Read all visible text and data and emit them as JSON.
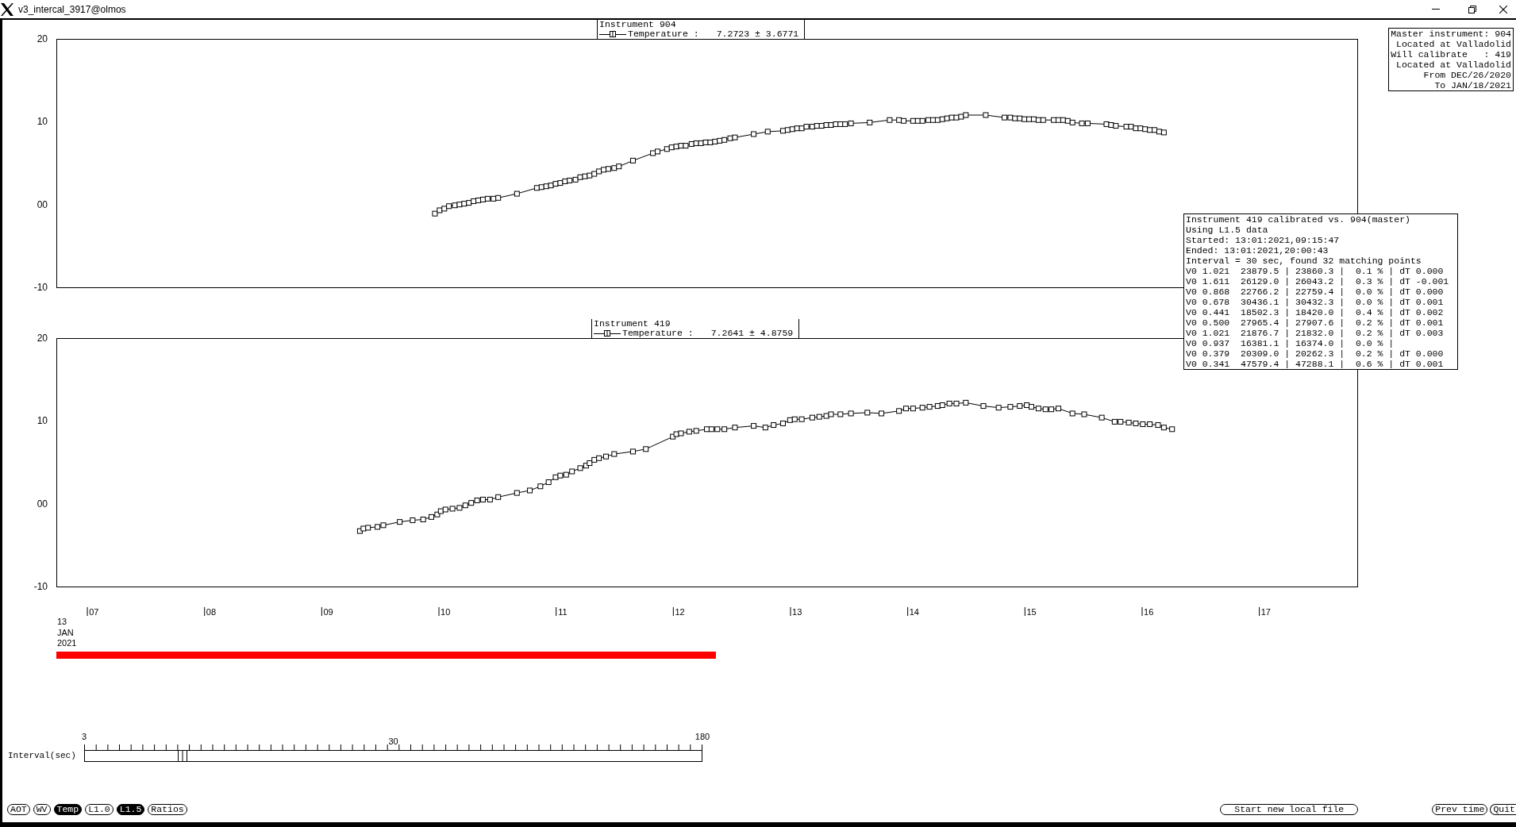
{
  "window": {
    "title": "v3_intercal_3917@olmos"
  },
  "charts": [
    {
      "legend": {
        "title": "Instrument 904",
        "label": "Temperature :",
        "stat": "7.2723 ± 3.6771"
      },
      "chart_data": {
        "type": "line",
        "marker": "square",
        "xlim": [
          6.68,
          17.78
        ],
        "ylim": [
          -10,
          20
        ],
        "yticks": [
          -10,
          {
            "value": 0,
            "label": "00"
          },
          10,
          20
        ],
        "x": [
          9.91,
          9.95,
          9.99,
          10.03,
          10.08,
          10.12,
          10.16,
          10.2,
          10.24,
          10.28,
          10.32,
          10.36,
          10.41,
          10.45,
          10.61,
          10.78,
          10.82,
          10.86,
          10.9,
          10.94,
          10.98,
          11.02,
          11.06,
          11.11,
          11.15,
          11.19,
          11.23,
          11.27,
          11.31,
          11.35,
          11.39,
          11.44,
          11.48,
          11.6,
          11.77,
          11.81,
          11.89,
          11.93,
          11.97,
          12.01,
          12.05,
          12.1,
          12.14,
          12.18,
          12.22,
          12.26,
          12.3,
          12.34,
          12.38,
          12.43,
          12.47,
          12.63,
          12.75,
          12.88,
          12.92,
          12.96,
          13.0,
          13.04,
          13.08,
          13.13,
          13.17,
          13.21,
          13.25,
          13.29,
          13.33,
          13.37,
          13.41,
          13.46,
          13.62,
          13.79,
          13.87,
          13.91,
          13.99,
          14.03,
          14.07,
          14.12,
          14.16,
          14.2,
          14.24,
          14.28,
          14.32,
          14.36,
          14.4,
          14.44,
          14.61,
          14.77,
          14.82,
          14.86,
          14.9,
          14.94,
          14.98,
          15.02,
          15.06,
          15.1,
          15.19,
          15.23,
          15.27,
          15.31,
          15.35,
          15.43,
          15.48,
          15.64,
          15.68,
          15.72,
          15.81,
          15.85,
          15.89,
          15.93,
          15.97,
          16.01,
          16.05,
          16.09,
          16.13
        ],
        "values": [
          -1.1,
          -0.7,
          -0.5,
          -0.2,
          -0.1,
          0.0,
          0.1,
          0.2,
          0.4,
          0.5,
          0.6,
          0.7,
          0.7,
          0.8,
          1.3,
          2.0,
          2.1,
          2.2,
          2.3,
          2.5,
          2.6,
          2.8,
          2.9,
          3.0,
          3.3,
          3.4,
          3.5,
          3.7,
          4.0,
          4.2,
          4.3,
          4.4,
          4.6,
          5.3,
          6.2,
          6.4,
          6.7,
          6.9,
          7.0,
          7.1,
          7.1,
          7.3,
          7.4,
          7.4,
          7.5,
          7.5,
          7.6,
          7.7,
          7.8,
          8.0,
          8.1,
          8.5,
          8.8,
          8.9,
          9.0,
          9.1,
          9.2,
          9.2,
          9.4,
          9.4,
          9.5,
          9.5,
          9.6,
          9.6,
          9.7,
          9.7,
          9.7,
          9.8,
          9.9,
          10.2,
          10.2,
          10.1,
          10.1,
          10.1,
          10.1,
          10.2,
          10.2,
          10.2,
          10.3,
          10.4,
          10.5,
          10.5,
          10.6,
          10.8,
          10.8,
          10.5,
          10.5,
          10.4,
          10.4,
          10.3,
          10.3,
          10.3,
          10.2,
          10.2,
          10.2,
          10.2,
          10.2,
          10.1,
          9.9,
          9.8,
          9.8,
          9.7,
          9.6,
          9.5,
          9.4,
          9.4,
          9.2,
          9.2,
          9.1,
          9.0,
          9.0,
          8.8,
          8.7
        ]
      }
    },
    {
      "legend": {
        "title": "Instrument 419",
        "label": "Temperature :",
        "stat": "7.2641 ± 4.8759"
      },
      "chart_data": {
        "type": "line",
        "marker": "square",
        "xlim": [
          6.68,
          17.78
        ],
        "ylim": [
          -10,
          20
        ],
        "yticks": [
          -10,
          {
            "value": 0,
            "label": "00"
          },
          10,
          20
        ],
        "xticks": [
          {
            "value": 7,
            "label": "07"
          },
          {
            "value": 8,
            "label": "08"
          },
          {
            "value": 9,
            "label": "09"
          },
          10,
          11,
          12,
          13,
          14,
          15,
          16,
          17
        ],
        "x": [
          9.27,
          9.3,
          9.34,
          9.42,
          9.47,
          9.61,
          9.72,
          9.81,
          9.88,
          9.93,
          9.96,
          10.0,
          10.06,
          10.12,
          10.17,
          10.22,
          10.27,
          10.32,
          10.38,
          10.45,
          10.61,
          10.72,
          10.81,
          10.88,
          10.94,
          10.98,
          11.03,
          11.08,
          11.15,
          11.2,
          11.23,
          11.27,
          11.31,
          11.37,
          11.44,
          11.6,
          11.71,
          11.94,
          11.97,
          12.01,
          12.08,
          12.14,
          12.23,
          12.27,
          12.32,
          12.38,
          12.47,
          12.63,
          12.73,
          12.8,
          12.88,
          12.94,
          12.98,
          13.04,
          13.13,
          13.19,
          13.25,
          13.29,
          13.37,
          13.46,
          13.6,
          13.72,
          13.87,
          13.93,
          13.99,
          14.07,
          14.13,
          14.2,
          14.24,
          14.3,
          14.36,
          14.44,
          14.59,
          14.72,
          14.82,
          14.9,
          14.96,
          15.0,
          15.06,
          15.12,
          15.17,
          15.23,
          15.35,
          15.45,
          15.6,
          15.71,
          15.76,
          15.83,
          15.89,
          15.95,
          16.01,
          16.08,
          16.13,
          16.2
        ],
        "values": [
          -3.3,
          -3.0,
          -2.9,
          -2.8,
          -2.6,
          -2.2,
          -2.0,
          -1.9,
          -1.6,
          -1.3,
          -0.9,
          -0.7,
          -0.6,
          -0.5,
          -0.2,
          0.1,
          0.4,
          0.5,
          0.5,
          0.8,
          1.3,
          1.6,
          2.1,
          2.6,
          3.2,
          3.4,
          3.5,
          3.9,
          4.3,
          4.6,
          4.9,
          5.3,
          5.5,
          5.7,
          6.0,
          6.3,
          6.6,
          8.1,
          8.4,
          8.5,
          8.7,
          8.8,
          9.0,
          9.0,
          9.0,
          9.0,
          9.2,
          9.4,
          9.2,
          9.5,
          9.7,
          10.1,
          10.2,
          10.2,
          10.4,
          10.5,
          10.6,
          10.8,
          10.8,
          10.9,
          11.0,
          10.9,
          11.2,
          11.5,
          11.5,
          11.6,
          11.7,
          11.8,
          11.9,
          12.1,
          12.1,
          12.2,
          11.8,
          11.6,
          11.7,
          11.8,
          11.9,
          11.7,
          11.5,
          11.4,
          11.4,
          11.5,
          10.9,
          10.8,
          10.4,
          9.9,
          9.9,
          9.8,
          9.7,
          9.6,
          9.6,
          9.5,
          9.2,
          9.0
        ]
      }
    }
  ],
  "master_info": {
    "lines": [
      "Master instrument: 904",
      "Located at Valladolid",
      "Will calibrate   : 419",
      "Located at Valladolid",
      "From DEC/26/2020",
      "To JAN/18/2021"
    ]
  },
  "calibration_report": {
    "lines": [
      "Instrument 419 calibrated vs. 904(master)",
      "Using L1.5 data",
      "Started: 13:01:2021,09:15:47",
      "Ended: 13:01:2021,20:00:43",
      "Interval = 30 sec, found 32 matching points",
      "V0 1.021  23879.5 | 23860.3 |  0.1 % | dT 0.000",
      "V0 1.611  26129.0 | 26043.2 |  0.3 % | dT -0.001",
      "V0 0.868  22766.2 | 22759.4 |  0.0 % | dT 0.000",
      "V0 0.678  30436.1 | 30432.3 |  0.0 % | dT 0.001",
      "V0 0.441  18502.3 | 18420.0 |  0.4 % | dT 0.002",
      "V0 0.500  27965.4 | 27907.6 |  0.2 % | dT 0.001",
      "V0 1.021  21876.7 | 21832.0 |  0.2 % | dT 0.003",
      "V0 0.937  16381.1 | 16374.0 |  0.0 % |",
      "V0 0.379  20309.0 | 20262.3 |  0.2 % | dT 0.000",
      "V0 0.341  47579.4 | 47288.1 |  0.6 % | dT 0.001"
    ]
  },
  "date_label": [
    "13",
    "JAN",
    "2021"
  ],
  "time_range_bar": {
    "level": 0.507
  },
  "interval_slider": {
    "label": "Interval(sec)",
    "scale_labels": [
      "3",
      "30",
      "180"
    ],
    "level": 0.158
  },
  "toggles": [
    {
      "label": "AOT",
      "selected": false
    },
    {
      "label": "WV",
      "selected": false
    },
    {
      "label": "Temp",
      "selected": true
    },
    {
      "label": "L1.0",
      "selected": false
    },
    {
      "label": "L1.5",
      "selected": true
    },
    {
      "label": "Ratios",
      "selected": false
    }
  ],
  "actions": [
    "Start new local file",
    "Prev time",
    "Quit"
  ]
}
